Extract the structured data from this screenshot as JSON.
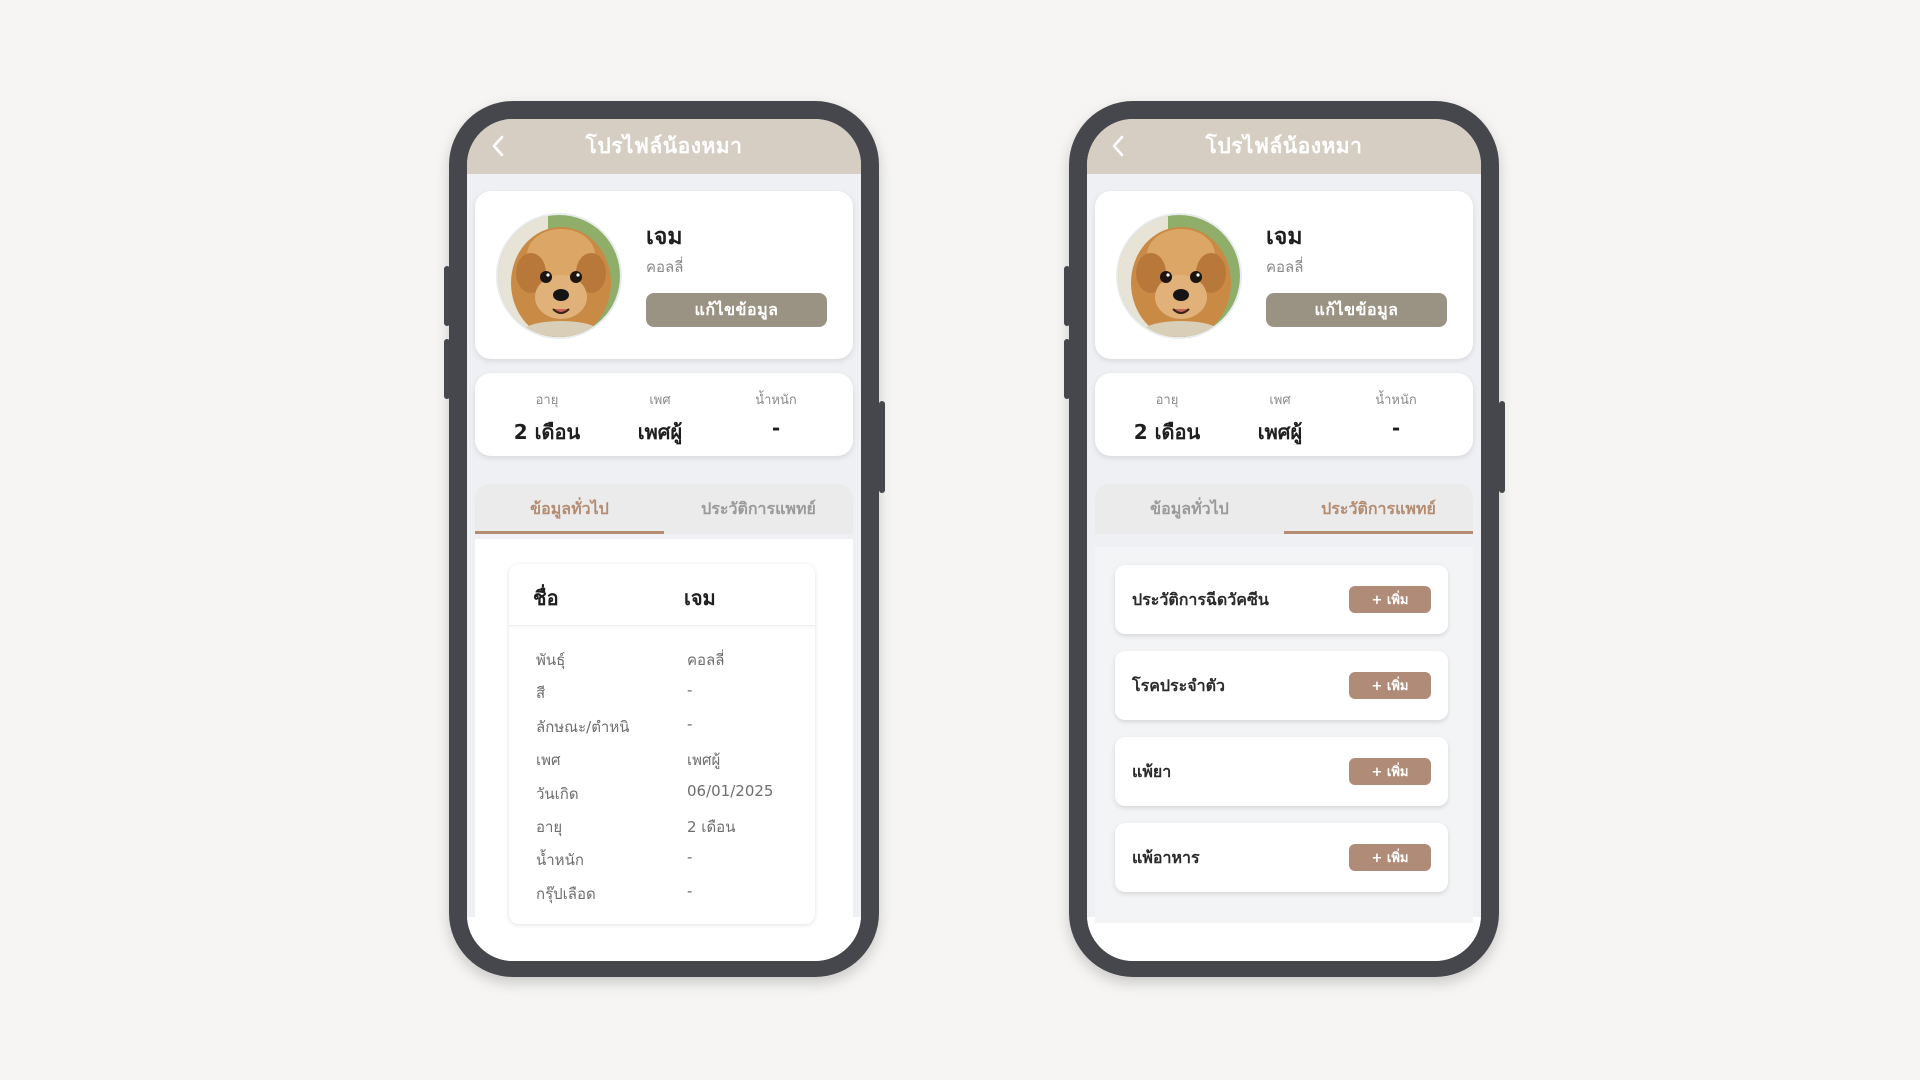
{
  "colors": {
    "header_bg": "#d6cdc3",
    "accent": "#b48c72",
    "edit_button": "#9a9384",
    "add_button": "#b08c78",
    "phone_frame": "#45474c"
  },
  "screens": [
    {
      "header": {
        "back_icon": "chevron-left-icon",
        "title": "โปรไฟล์น้องหมา"
      },
      "profile": {
        "name": "เจม",
        "breed": "คอลลี่",
        "edit_label": "แก้ไขข้อมูล"
      },
      "stats": [
        {
          "label": "อายุ",
          "value": "2 เดือน"
        },
        {
          "label": "เพศ",
          "value": "เพศผู้"
        },
        {
          "label": "น้ำหนัก",
          "value": "-"
        }
      ],
      "tabs": [
        {
          "label": "ข้อมูลทั่วไป",
          "active": true
        },
        {
          "label": "ประวัติการแพทย์",
          "active": false
        }
      ],
      "info": {
        "head_label": "ชื่อ",
        "head_value": "เจม",
        "rows": [
          {
            "key": "พันธุ์",
            "value": "คอลลี่"
          },
          {
            "key": "สี",
            "value": "-"
          },
          {
            "key": "ลักษณะ/ตำหนิ",
            "value": "-"
          },
          {
            "key": "เพศ",
            "value": "เพศผู้"
          },
          {
            "key": "วันเกิด",
            "value": "06/01/2025"
          },
          {
            "key": "อายุ",
            "value": "2 เดือน"
          },
          {
            "key": "น้ำหนัก",
            "value": "-"
          },
          {
            "key": "กรุ๊ปเลือด",
            "value": "-"
          }
        ]
      }
    },
    {
      "header": {
        "back_icon": "chevron-left-icon",
        "title": "โปรไฟล์น้องหมา"
      },
      "profile": {
        "name": "เจม",
        "breed": "คอลลี่",
        "edit_label": "แก้ไขข้อมูล"
      },
      "stats": [
        {
          "label": "อายุ",
          "value": "2 เดือน"
        },
        {
          "label": "เพศ",
          "value": "เพศผู้"
        },
        {
          "label": "น้ำหนัก",
          "value": "-"
        }
      ],
      "tabs": [
        {
          "label": "ข้อมูลทั่วไป",
          "active": false
        },
        {
          "label": "ประวัติการแพทย์",
          "active": true
        }
      ],
      "medical": {
        "add_label": "+ เพิ่ม",
        "items": [
          {
            "label": "ประวัติการฉีดวัคซีน"
          },
          {
            "label": "โรคประจำตัว"
          },
          {
            "label": "แพ้ยา"
          },
          {
            "label": "แพ้อาหาร"
          }
        ]
      }
    }
  ]
}
